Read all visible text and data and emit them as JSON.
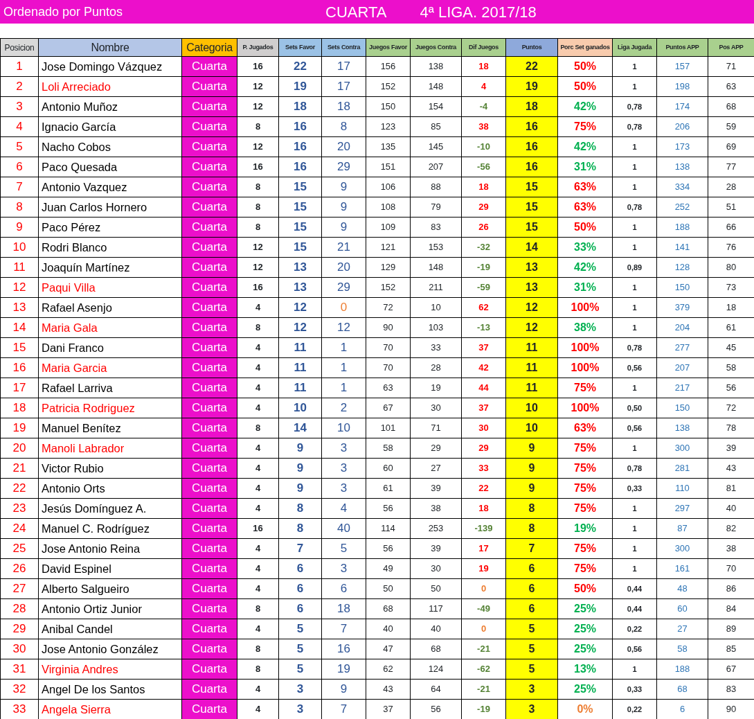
{
  "title_bar": {
    "left": "Ordenado por Puntos",
    "category": "CUARTA",
    "league": "4ª LIGA. 2017/18"
  },
  "columns": [
    {
      "label": "Posicion",
      "color": "#d9d9d9"
    },
    {
      "label": "Nombre",
      "color": "#b4c6e7"
    },
    {
      "label": "Categoria",
      "color": "#ffc000"
    },
    {
      "label": "P. Jugados",
      "color": "#d0cece"
    },
    {
      "label": "Sets Favor",
      "color": "#9bc2e6"
    },
    {
      "label": "Sets Contra",
      "color": "#9bc2e6"
    },
    {
      "label": "Juegos Favor",
      "color": "#a9d08e"
    },
    {
      "label": "Juegos Contra",
      "color": "#a9d08e"
    },
    {
      "label": "Dif Juegos",
      "color": "#a9d08e"
    },
    {
      "label": "Puntos",
      "color": "#8ea9db"
    },
    {
      "label": "Porc Set ganados",
      "color": "#f8cbad"
    },
    {
      "label": "Liga Jugada",
      "color": "#a9d08e"
    },
    {
      "label": "Puntos APP",
      "color": "#a9d08e"
    },
    {
      "label": "Pos APP",
      "color": "#a9d08e"
    }
  ],
  "rows": [
    {
      "posicion": "1",
      "nombre": {
        "text": "Jose Domingo Vázquez",
        "color": "#000000"
      },
      "categoria": "Cuarta",
      "p_jugados": "16",
      "sets_favor": "22",
      "sets_contra": {
        "text": "17",
        "color": "#2f5597"
      },
      "juegos_favor": "156",
      "juegos_contra": "138",
      "dif_juegos": {
        "text": "18",
        "color": "#ff0000"
      },
      "puntos": "22",
      "porc_sets": {
        "text": "50%",
        "color": "#ff0000"
      },
      "liga_jugada": "1",
      "puntos_app": "157",
      "pos_app": "71"
    },
    {
      "posicion": "2",
      "nombre": {
        "text": "Loli Arreciado",
        "color": "#ff0000"
      },
      "categoria": "Cuarta",
      "p_jugados": "12",
      "sets_favor": "19",
      "sets_contra": {
        "text": "17",
        "color": "#2f5597"
      },
      "juegos_favor": "152",
      "juegos_contra": "148",
      "dif_juegos": {
        "text": "4",
        "color": "#ff0000"
      },
      "puntos": "19",
      "porc_sets": {
        "text": "50%",
        "color": "#ff0000"
      },
      "liga_jugada": "1",
      "puntos_app": "198",
      "pos_app": "63"
    },
    {
      "posicion": "3",
      "nombre": {
        "text": "Antonio Muñoz",
        "color": "#000000"
      },
      "categoria": "Cuarta",
      "p_jugados": "12",
      "sets_favor": "18",
      "sets_contra": {
        "text": "18",
        "color": "#2f5597"
      },
      "juegos_favor": "150",
      "juegos_contra": "154",
      "dif_juegos": {
        "text": "-4",
        "color": "#548235"
      },
      "puntos": "18",
      "porc_sets": {
        "text": "42%",
        "color": "#00b050"
      },
      "liga_jugada": "0,78",
      "puntos_app": "174",
      "pos_app": "68"
    },
    {
      "posicion": "4",
      "nombre": {
        "text": "Ignacio García",
        "color": "#000000"
      },
      "categoria": "Cuarta",
      "p_jugados": "8",
      "sets_favor": "16",
      "sets_contra": {
        "text": "8",
        "color": "#2f5597"
      },
      "juegos_favor": "123",
      "juegos_contra": "85",
      "dif_juegos": {
        "text": "38",
        "color": "#ff0000"
      },
      "puntos": "16",
      "porc_sets": {
        "text": "75%",
        "color": "#ff0000"
      },
      "liga_jugada": "0,78",
      "puntos_app": "206",
      "pos_app": "59"
    },
    {
      "posicion": "5",
      "nombre": {
        "text": "Nacho Cobos",
        "color": "#000000"
      },
      "categoria": "Cuarta",
      "p_jugados": "12",
      "sets_favor": "16",
      "sets_contra": {
        "text": "20",
        "color": "#2f5597"
      },
      "juegos_favor": "135",
      "juegos_contra": "145",
      "dif_juegos": {
        "text": "-10",
        "color": "#548235"
      },
      "puntos": "16",
      "porc_sets": {
        "text": "42%",
        "color": "#00b050"
      },
      "liga_jugada": "1",
      "puntos_app": "173",
      "pos_app": "69"
    },
    {
      "posicion": "6",
      "nombre": {
        "text": "Paco Quesada",
        "color": "#000000"
      },
      "categoria": "Cuarta",
      "p_jugados": "16",
      "sets_favor": "16",
      "sets_contra": {
        "text": "29",
        "color": "#2f5597"
      },
      "juegos_favor": "151",
      "juegos_contra": "207",
      "dif_juegos": {
        "text": "-56",
        "color": "#548235"
      },
      "puntos": "16",
      "porc_sets": {
        "text": "31%",
        "color": "#00b050"
      },
      "liga_jugada": "1",
      "puntos_app": "138",
      "pos_app": "77"
    },
    {
      "posicion": "7",
      "nombre": {
        "text": "Antonio Vazquez",
        "color": "#000000"
      },
      "categoria": "Cuarta",
      "p_jugados": "8",
      "sets_favor": "15",
      "sets_contra": {
        "text": "9",
        "color": "#2f5597"
      },
      "juegos_favor": "106",
      "juegos_contra": "88",
      "dif_juegos": {
        "text": "18",
        "color": "#ff0000"
      },
      "puntos": "15",
      "porc_sets": {
        "text": "63%",
        "color": "#ff0000"
      },
      "liga_jugada": "1",
      "puntos_app": "334",
      "pos_app": "28"
    },
    {
      "posicion": "8",
      "nombre": {
        "text": "Juan Carlos Hornero",
        "color": "#000000"
      },
      "categoria": "Cuarta",
      "p_jugados": "8",
      "sets_favor": "15",
      "sets_contra": {
        "text": "9",
        "color": "#2f5597"
      },
      "juegos_favor": "108",
      "juegos_contra": "79",
      "dif_juegos": {
        "text": "29",
        "color": "#ff0000"
      },
      "puntos": "15",
      "porc_sets": {
        "text": "63%",
        "color": "#ff0000"
      },
      "liga_jugada": "0,78",
      "puntos_app": "252",
      "pos_app": "51"
    },
    {
      "posicion": "9",
      "nombre": {
        "text": "Paco Pérez",
        "color": "#000000"
      },
      "categoria": "Cuarta",
      "p_jugados": "8",
      "sets_favor": "15",
      "sets_contra": {
        "text": "9",
        "color": "#2f5597"
      },
      "juegos_favor": "109",
      "juegos_contra": "83",
      "dif_juegos": {
        "text": "26",
        "color": "#ff0000"
      },
      "puntos": "15",
      "porc_sets": {
        "text": "50%",
        "color": "#ff0000"
      },
      "liga_jugada": "1",
      "puntos_app": "188",
      "pos_app": "66"
    },
    {
      "posicion": "10",
      "nombre": {
        "text": "Rodri Blanco",
        "color": "#000000"
      },
      "categoria": "Cuarta",
      "p_jugados": "12",
      "sets_favor": "15",
      "sets_contra": {
        "text": "21",
        "color": "#2f5597"
      },
      "juegos_favor": "121",
      "juegos_contra": "153",
      "dif_juegos": {
        "text": "-32",
        "color": "#548235"
      },
      "puntos": "14",
      "porc_sets": {
        "text": "33%",
        "color": "#00b050"
      },
      "liga_jugada": "1",
      "puntos_app": "141",
      "pos_app": "76"
    },
    {
      "posicion": "11",
      "nombre": {
        "text": "Joaquín Martínez",
        "color": "#000000"
      },
      "categoria": "Cuarta",
      "p_jugados": "12",
      "sets_favor": "13",
      "sets_contra": {
        "text": "20",
        "color": "#2f5597"
      },
      "juegos_favor": "129",
      "juegos_contra": "148",
      "dif_juegos": {
        "text": "-19",
        "color": "#548235"
      },
      "puntos": "13",
      "porc_sets": {
        "text": "42%",
        "color": "#00b050"
      },
      "liga_jugada": "0,89",
      "puntos_app": "128",
      "pos_app": "80"
    },
    {
      "posicion": "12",
      "nombre": {
        "text": "Paqui Villa",
        "color": "#ff0000"
      },
      "categoria": "Cuarta",
      "p_jugados": "16",
      "sets_favor": "13",
      "sets_contra": {
        "text": "29",
        "color": "#2f5597"
      },
      "juegos_favor": "152",
      "juegos_contra": "211",
      "dif_juegos": {
        "text": "-59",
        "color": "#548235"
      },
      "puntos": "13",
      "porc_sets": {
        "text": "31%",
        "color": "#00b050"
      },
      "liga_jugada": "1",
      "puntos_app": "150",
      "pos_app": "73"
    },
    {
      "posicion": "13",
      "nombre": {
        "text": "Rafael Asenjo",
        "color": "#000000"
      },
      "categoria": "Cuarta",
      "p_jugados": "4",
      "sets_favor": "12",
      "sets_contra": {
        "text": "0",
        "color": "#ed7d31"
      },
      "juegos_favor": "72",
      "juegos_contra": "10",
      "dif_juegos": {
        "text": "62",
        "color": "#ff0000"
      },
      "puntos": "12",
      "porc_sets": {
        "text": "100%",
        "color": "#ff0000"
      },
      "liga_jugada": "1",
      "puntos_app": "379",
      "pos_app": "18"
    },
    {
      "posicion": "14",
      "nombre": {
        "text": "Maria Gala",
        "color": "#ff0000"
      },
      "categoria": "Cuarta",
      "p_jugados": "8",
      "sets_favor": "12",
      "sets_contra": {
        "text": "12",
        "color": "#2f5597"
      },
      "juegos_favor": "90",
      "juegos_contra": "103",
      "dif_juegos": {
        "text": "-13",
        "color": "#548235"
      },
      "puntos": "12",
      "porc_sets": {
        "text": "38%",
        "color": "#00b050"
      },
      "liga_jugada": "1",
      "puntos_app": "204",
      "pos_app": "61"
    },
    {
      "posicion": "15",
      "nombre": {
        "text": "Dani Franco",
        "color": "#000000"
      },
      "categoria": "Cuarta",
      "p_jugados": "4",
      "sets_favor": "11",
      "sets_contra": {
        "text": "1",
        "color": "#2f5597"
      },
      "juegos_favor": "70",
      "juegos_contra": "33",
      "dif_juegos": {
        "text": "37",
        "color": "#ff0000"
      },
      "puntos": "11",
      "porc_sets": {
        "text": "100%",
        "color": "#ff0000"
      },
      "liga_jugada": "0,78",
      "puntos_app": "277",
      "pos_app": "45"
    },
    {
      "posicion": "16",
      "nombre": {
        "text": "Maria Garcia",
        "color": "#ff0000"
      },
      "categoria": "Cuarta",
      "p_jugados": "4",
      "sets_favor": "11",
      "sets_contra": {
        "text": "1",
        "color": "#2f5597"
      },
      "juegos_favor": "70",
      "juegos_contra": "28",
      "dif_juegos": {
        "text": "42",
        "color": "#ff0000"
      },
      "puntos": "11",
      "porc_sets": {
        "text": "100%",
        "color": "#ff0000"
      },
      "liga_jugada": "0,56",
      "puntos_app": "207",
      "pos_app": "58"
    },
    {
      "posicion": "17",
      "nombre": {
        "text": "Rafael Larriva",
        "color": "#000000"
      },
      "categoria": "Cuarta",
      "p_jugados": "4",
      "sets_favor": "11",
      "sets_contra": {
        "text": "1",
        "color": "#2f5597"
      },
      "juegos_favor": "63",
      "juegos_contra": "19",
      "dif_juegos": {
        "text": "44",
        "color": "#ff0000"
      },
      "puntos": "11",
      "porc_sets": {
        "text": "75%",
        "color": "#ff0000"
      },
      "liga_jugada": "1",
      "puntos_app": "217",
      "pos_app": "56"
    },
    {
      "posicion": "18",
      "nombre": {
        "text": "Patricia Rodriguez",
        "color": "#ff0000"
      },
      "categoria": "Cuarta",
      "p_jugados": "4",
      "sets_favor": "10",
      "sets_contra": {
        "text": "2",
        "color": "#2f5597"
      },
      "juegos_favor": "67",
      "juegos_contra": "30",
      "dif_juegos": {
        "text": "37",
        "color": "#ff0000"
      },
      "puntos": "10",
      "porc_sets": {
        "text": "100%",
        "color": "#ff0000"
      },
      "liga_jugada": "0,50",
      "puntos_app": "150",
      "pos_app": "72"
    },
    {
      "posicion": "19",
      "nombre": {
        "text": "Manuel Benítez",
        "color": "#000000"
      },
      "categoria": "Cuarta",
      "p_jugados": "8",
      "sets_favor": "14",
      "sets_contra": {
        "text": "10",
        "color": "#2f5597"
      },
      "juegos_favor": "101",
      "juegos_contra": "71",
      "dif_juegos": {
        "text": "30",
        "color": "#ff0000"
      },
      "puntos": "10",
      "porc_sets": {
        "text": "63%",
        "color": "#ff0000"
      },
      "liga_jugada": "0,56",
      "puntos_app": "138",
      "pos_app": "78"
    },
    {
      "posicion": "20",
      "nombre": {
        "text": "Manoli Labrador",
        "color": "#ff0000"
      },
      "categoria": "Cuarta",
      "p_jugados": "4",
      "sets_favor": "9",
      "sets_contra": {
        "text": "3",
        "color": "#2f5597"
      },
      "juegos_favor": "58",
      "juegos_contra": "29",
      "dif_juegos": {
        "text": "29",
        "color": "#ff0000"
      },
      "puntos": "9",
      "porc_sets": {
        "text": "75%",
        "color": "#ff0000"
      },
      "liga_jugada": "1",
      "puntos_app": "300",
      "pos_app": "39"
    },
    {
      "posicion": "21",
      "nombre": {
        "text": "Victor Rubio",
        "color": "#000000"
      },
      "categoria": "Cuarta",
      "p_jugados": "4",
      "sets_favor": "9",
      "sets_contra": {
        "text": "3",
        "color": "#2f5597"
      },
      "juegos_favor": "60",
      "juegos_contra": "27",
      "dif_juegos": {
        "text": "33",
        "color": "#ff0000"
      },
      "puntos": "9",
      "porc_sets": {
        "text": "75%",
        "color": "#ff0000"
      },
      "liga_jugada": "0,78",
      "puntos_app": "281",
      "pos_app": "43"
    },
    {
      "posicion": "22",
      "nombre": {
        "text": "Antonio Orts",
        "color": "#000000"
      },
      "categoria": "Cuarta",
      "p_jugados": "4",
      "sets_favor": "9",
      "sets_contra": {
        "text": "3",
        "color": "#2f5597"
      },
      "juegos_favor": "61",
      "juegos_contra": "39",
      "dif_juegos": {
        "text": "22",
        "color": "#ff0000"
      },
      "puntos": "9",
      "porc_sets": {
        "text": "75%",
        "color": "#ff0000"
      },
      "liga_jugada": "0,33",
      "puntos_app": "110",
      "pos_app": "81"
    },
    {
      "posicion": "23",
      "nombre": {
        "text": "Jesús Domínguez A.",
        "color": "#000000"
      },
      "categoria": "Cuarta",
      "p_jugados": "4",
      "sets_favor": "8",
      "sets_contra": {
        "text": "4",
        "color": "#2f5597"
      },
      "juegos_favor": "56",
      "juegos_contra": "38",
      "dif_juegos": {
        "text": "18",
        "color": "#ff0000"
      },
      "puntos": "8",
      "porc_sets": {
        "text": "75%",
        "color": "#ff0000"
      },
      "liga_jugada": "1",
      "puntos_app": "297",
      "pos_app": "40"
    },
    {
      "posicion": "24",
      "nombre": {
        "text": "Manuel C. Rodríguez",
        "color": "#000000"
      },
      "categoria": "Cuarta",
      "p_jugados": "16",
      "sets_favor": "8",
      "sets_contra": {
        "text": "40",
        "color": "#2f5597"
      },
      "juegos_favor": "114",
      "juegos_contra": "253",
      "dif_juegos": {
        "text": "-139",
        "color": "#548235"
      },
      "puntos": "8",
      "porc_sets": {
        "text": "19%",
        "color": "#00b050"
      },
      "liga_jugada": "1",
      "puntos_app": "87",
      "pos_app": "82"
    },
    {
      "posicion": "25",
      "nombre": {
        "text": "Jose Antonio Reina",
        "color": "#000000"
      },
      "categoria": "Cuarta",
      "p_jugados": "4",
      "sets_favor": "7",
      "sets_contra": {
        "text": "5",
        "color": "#2f5597"
      },
      "juegos_favor": "56",
      "juegos_contra": "39",
      "dif_juegos": {
        "text": "17",
        "color": "#ff0000"
      },
      "puntos": "7",
      "porc_sets": {
        "text": "75%",
        "color": "#ff0000"
      },
      "liga_jugada": "1",
      "puntos_app": "300",
      "pos_app": "38"
    },
    {
      "posicion": "26",
      "nombre": {
        "text": "David Espinel",
        "color": "#000000"
      },
      "categoria": "Cuarta",
      "p_jugados": "4",
      "sets_favor": "6",
      "sets_contra": {
        "text": "3",
        "color": "#2f5597"
      },
      "juegos_favor": "49",
      "juegos_contra": "30",
      "dif_juegos": {
        "text": "19",
        "color": "#ff0000"
      },
      "puntos": "6",
      "porc_sets": {
        "text": "75%",
        "color": "#ff0000"
      },
      "liga_jugada": "1",
      "puntos_app": "161",
      "pos_app": "70"
    },
    {
      "posicion": "27",
      "nombre": {
        "text": "Alberto Salgueiro",
        "color": "#000000"
      },
      "categoria": "Cuarta",
      "p_jugados": "4",
      "sets_favor": "6",
      "sets_contra": {
        "text": "6",
        "color": "#2f5597"
      },
      "juegos_favor": "50",
      "juegos_contra": "50",
      "dif_juegos": {
        "text": "0",
        "color": "#ed7d31"
      },
      "puntos": "6",
      "porc_sets": {
        "text": "50%",
        "color": "#ff0000"
      },
      "liga_jugada": "0,44",
      "puntos_app": "48",
      "pos_app": "86"
    },
    {
      "posicion": "28",
      "nombre": {
        "text": "Antonio Ortiz Junior",
        "color": "#000000"
      },
      "categoria": "Cuarta",
      "p_jugados": "8",
      "sets_favor": "6",
      "sets_contra": {
        "text": "18",
        "color": "#2f5597"
      },
      "juegos_favor": "68",
      "juegos_contra": "117",
      "dif_juegos": {
        "text": "-49",
        "color": "#548235"
      },
      "puntos": "6",
      "porc_sets": {
        "text": "25%",
        "color": "#00b050"
      },
      "liga_jugada": "0,44",
      "puntos_app": "60",
      "pos_app": "84"
    },
    {
      "posicion": "29",
      "nombre": {
        "text": "Anibal Candel",
        "color": "#000000"
      },
      "categoria": "Cuarta",
      "p_jugados": "4",
      "sets_favor": "5",
      "sets_contra": {
        "text": "7",
        "color": "#2f5597"
      },
      "juegos_favor": "40",
      "juegos_contra": "40",
      "dif_juegos": {
        "text": "0",
        "color": "#ed7d31"
      },
      "puntos": "5",
      "porc_sets": {
        "text": "25%",
        "color": "#00b050"
      },
      "liga_jugada": "0,22",
      "puntos_app": "27",
      "pos_app": "89"
    },
    {
      "posicion": "30",
      "nombre": {
        "text": "Jose Antonio González",
        "color": "#000000"
      },
      "categoria": "Cuarta",
      "p_jugados": "8",
      "sets_favor": "5",
      "sets_contra": {
        "text": "16",
        "color": "#2f5597"
      },
      "juegos_favor": "47",
      "juegos_contra": "68",
      "dif_juegos": {
        "text": "-21",
        "color": "#548235"
      },
      "puntos": "5",
      "porc_sets": {
        "text": "25%",
        "color": "#00b050"
      },
      "liga_jugada": "0,56",
      "puntos_app": "58",
      "pos_app": "85"
    },
    {
      "posicion": "31",
      "nombre": {
        "text": "Virginia Andres",
        "color": "#ff0000"
      },
      "categoria": "Cuarta",
      "p_jugados": "8",
      "sets_favor": "5",
      "sets_contra": {
        "text": "19",
        "color": "#2f5597"
      },
      "juegos_favor": "62",
      "juegos_contra": "124",
      "dif_juegos": {
        "text": "-62",
        "color": "#548235"
      },
      "puntos": "5",
      "porc_sets": {
        "text": "13%",
        "color": "#00b050"
      },
      "liga_jugada": "1",
      "puntos_app": "188",
      "pos_app": "67"
    },
    {
      "posicion": "32",
      "nombre": {
        "text": "Angel De los Santos",
        "color": "#000000"
      },
      "categoria": "Cuarta",
      "p_jugados": "4",
      "sets_favor": "3",
      "sets_contra": {
        "text": "9",
        "color": "#2f5597"
      },
      "juegos_favor": "43",
      "juegos_contra": "64",
      "dif_juegos": {
        "text": "-21",
        "color": "#548235"
      },
      "puntos": "3",
      "porc_sets": {
        "text": "25%",
        "color": "#00b050"
      },
      "liga_jugada": "0,33",
      "puntos_app": "68",
      "pos_app": "83"
    },
    {
      "posicion": "33",
      "nombre": {
        "text": "Angela Sierra",
        "color": "#ff0000"
      },
      "categoria": "Cuarta",
      "p_jugados": "4",
      "sets_favor": "3",
      "sets_contra": {
        "text": "7",
        "color": "#2f5597"
      },
      "juegos_favor": "37",
      "juegos_contra": "56",
      "dif_juegos": {
        "text": "-19",
        "color": "#548235"
      },
      "puntos": "3",
      "porc_sets": {
        "text": "0%",
        "color": "#ed7d31"
      },
      "liga_jugada": "0,22",
      "puntos_app": "6",
      "pos_app": "90"
    }
  ]
}
